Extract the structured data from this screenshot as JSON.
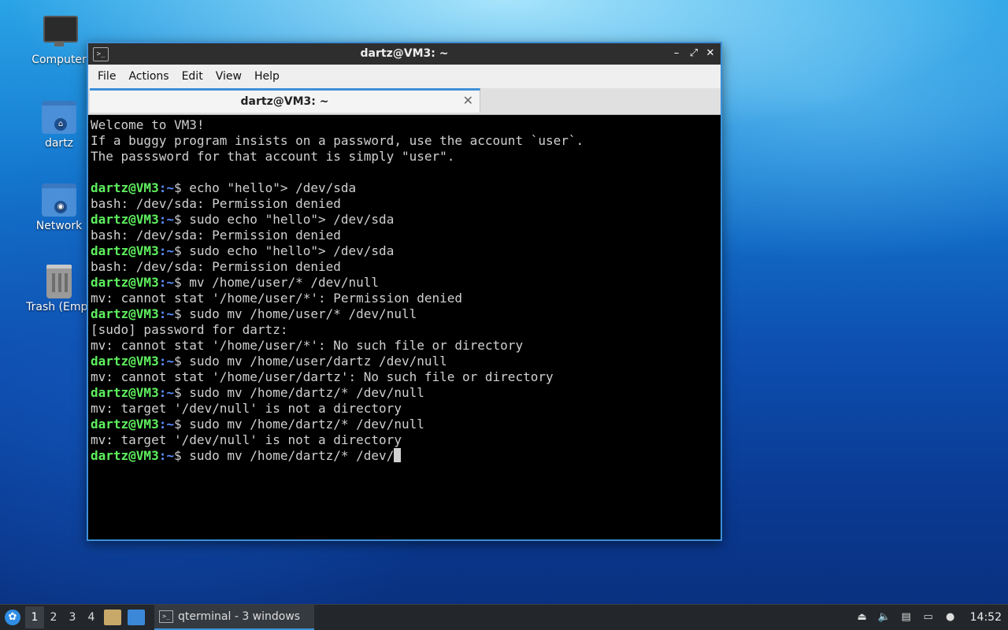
{
  "desktop": {
    "icons": [
      {
        "label": "Computer",
        "icon": "computer-icon"
      },
      {
        "label": "dartz",
        "icon": "home-folder-icon"
      },
      {
        "label": "Network",
        "icon": "network-folder-icon"
      },
      {
        "label": "Trash (Empt",
        "icon": "trash-icon"
      }
    ]
  },
  "window": {
    "title": "dartz@VM3: ~",
    "controls": {
      "minimize": "–",
      "maximize": "⤢",
      "close": "✕"
    },
    "menu": [
      "File",
      "Actions",
      "Edit",
      "View",
      "Help"
    ],
    "tab": {
      "title": "dartz@VM3: ~",
      "close": "✕"
    },
    "accent": "#3d8fd8"
  },
  "terminal": {
    "prompt_user": "dartz@VM3",
    "prompt_path": ":~",
    "prompt_symbol": "$ ",
    "prompt_color": "#5ff05f",
    "path_color": "#5a8fff",
    "lines": [
      {
        "type": "out",
        "text": "Welcome to VM3!"
      },
      {
        "type": "out",
        "text": "If a buggy program insists on a password, use the account `user`."
      },
      {
        "type": "out",
        "text": "The passsword for that account is simply \"user\"."
      },
      {
        "type": "out",
        "text": ""
      },
      {
        "type": "cmd",
        "text": "echo \"hello\"> /dev/sda"
      },
      {
        "type": "out",
        "text": "bash: /dev/sda: Permission denied"
      },
      {
        "type": "cmd",
        "text": "sudo echo \"hello\"> /dev/sda"
      },
      {
        "type": "out",
        "text": "bash: /dev/sda: Permission denied"
      },
      {
        "type": "cmd",
        "text": "sudo echo \"hello\"> /dev/sda"
      },
      {
        "type": "out",
        "text": "bash: /dev/sda: Permission denied"
      },
      {
        "type": "cmd",
        "text": "mv /home/user/* /dev/null"
      },
      {
        "type": "out",
        "text": "mv: cannot stat '/home/user/*': Permission denied"
      },
      {
        "type": "cmd",
        "text": "sudo mv /home/user/* /dev/null"
      },
      {
        "type": "out",
        "text": "[sudo] password for dartz:"
      },
      {
        "type": "out",
        "text": "mv: cannot stat '/home/user/*': No such file or directory"
      },
      {
        "type": "cmd",
        "text": "sudo mv /home/user/dartz /dev/null"
      },
      {
        "type": "out",
        "text": "mv: cannot stat '/home/user/dartz': No such file or directory"
      },
      {
        "type": "cmd",
        "text": "sudo mv /home/dartz/* /dev/null"
      },
      {
        "type": "out",
        "text": "mv: target '/dev/null' is not a directory"
      },
      {
        "type": "cmd",
        "text": "sudo mv /home/dartz/* /dev/null"
      },
      {
        "type": "out",
        "text": "mv: target '/dev/null' is not a directory"
      },
      {
        "type": "cmd",
        "text": "sudo mv /home/dartz/* /dev/",
        "cursor": true
      }
    ]
  },
  "taskbar": {
    "start_icon": "lxqt-logo-icon",
    "workspaces": [
      "1",
      "2",
      "3",
      "4"
    ],
    "active_workspace": "1",
    "task_label": "qterminal - 3 windows",
    "tray_icons": [
      "eject-icon",
      "volume-icon",
      "clipboard-icon",
      "network-icon",
      "update-icon"
    ],
    "clock": "14:52"
  }
}
